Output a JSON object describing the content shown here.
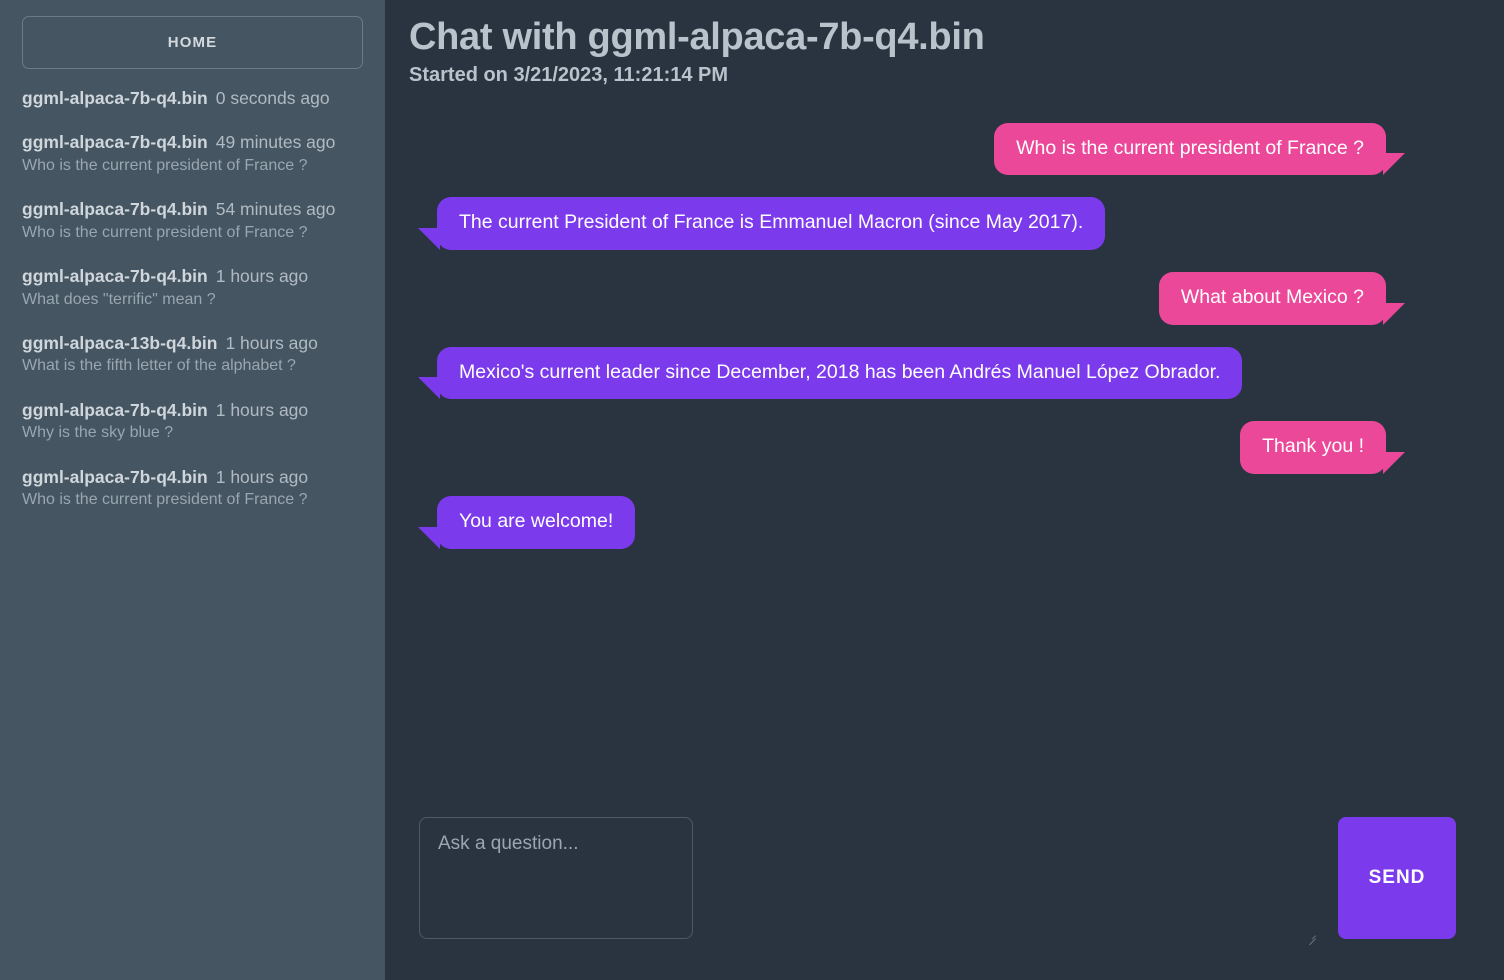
{
  "sidebar": {
    "home_label": "HOME",
    "history": [
      {
        "name": "ggml-alpaca-7b-q4.bin",
        "time": "0 seconds ago",
        "snippet": ""
      },
      {
        "name": "ggml-alpaca-7b-q4.bin",
        "time": "49 minutes ago",
        "snippet": "Who is the current president of France ?"
      },
      {
        "name": "ggml-alpaca-7b-q4.bin",
        "time": "54 minutes ago",
        "snippet": "Who is the current president of France ?"
      },
      {
        "name": "ggml-alpaca-7b-q4.bin",
        "time": "1 hours ago",
        "snippet": "What does \"terrific\" mean ?"
      },
      {
        "name": "ggml-alpaca-13b-q4.bin",
        "time": "1 hours ago",
        "snippet": "What is the fifth letter of the alphabet ?"
      },
      {
        "name": "ggml-alpaca-7b-q4.bin",
        "time": "1 hours ago",
        "snippet": "Why is the sky blue ?"
      },
      {
        "name": "ggml-alpaca-7b-q4.bin",
        "time": "1 hours ago",
        "snippet": "Who is the current president of France ?"
      }
    ]
  },
  "header": {
    "title": "Chat with ggml-alpaca-7b-q4.bin",
    "subtitle": "Started on 3/21/2023, 11:21:14 PM"
  },
  "messages": [
    {
      "role": "user",
      "text": "Who is the current president of France ?"
    },
    {
      "role": "bot",
      "text": "The current President of France is Emmanuel Macron (since May 2017)."
    },
    {
      "role": "user",
      "text": "What about Mexico ?"
    },
    {
      "role": "bot",
      "text": "Mexico's current leader since December, 2018 has been Andrés Manuel López Obrador."
    },
    {
      "role": "user",
      "text": "Thank you !"
    },
    {
      "role": "bot",
      "text": "You are welcome!"
    }
  ],
  "composer": {
    "placeholder": "Ask a question...",
    "value": "",
    "send_label": "SEND"
  },
  "colors": {
    "sidebar_bg": "#455561",
    "main_bg": "#2a3440",
    "user_bubble": "#ec4899",
    "bot_bubble": "#7c3aed",
    "accent": "#7c3aed"
  }
}
